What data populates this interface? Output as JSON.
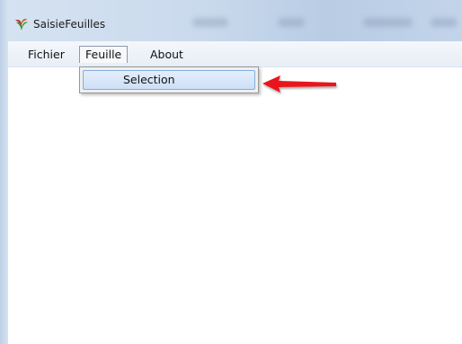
{
  "window": {
    "title": "SaisieFeuilles",
    "icon": "plant-app-icon"
  },
  "menubar": {
    "items": [
      {
        "label": "Fichier"
      },
      {
        "label": "Feuille"
      },
      {
        "label": "About"
      }
    ]
  },
  "dropdown": {
    "parent": "Feuille",
    "items": [
      {
        "label": "Selection"
      }
    ]
  },
  "annotation": {
    "icon": "red-arrow-icon",
    "color": "#e8131b"
  },
  "colors": {
    "selection_highlight": "#cde0f7",
    "selection_border": "#84acdd"
  }
}
